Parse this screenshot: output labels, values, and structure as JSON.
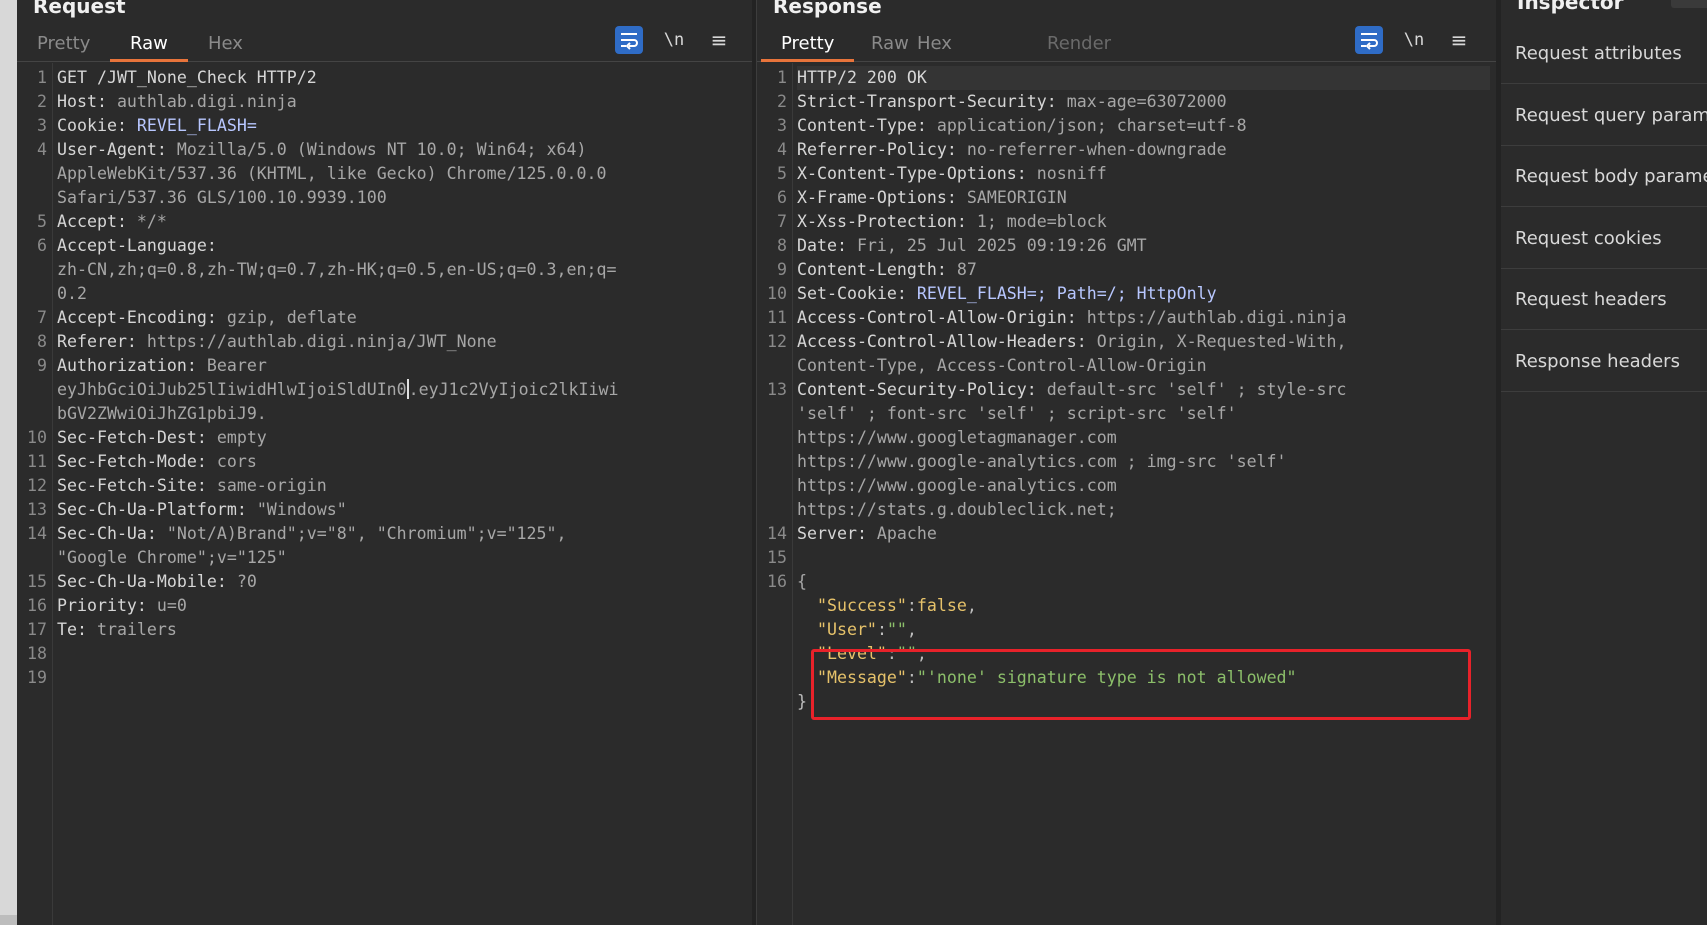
{
  "request": {
    "title": "Request",
    "tabs": [
      "Pretty",
      "Raw",
      "Hex"
    ],
    "active_tab": "Raw",
    "toolbar": {
      "newline_label": "\\n"
    },
    "lines": [
      {
        "n": "1",
        "k": "GET /JWT_None_Check HTTP/2",
        "v": ""
      },
      {
        "n": "2",
        "k": "Host:",
        "v": " authlab.digi.ninja"
      },
      {
        "n": "3",
        "k": "Cookie:",
        "v": " REVEL_FLASH="
      },
      {
        "n": "4",
        "k": "User-Agent:",
        "v": " Mozilla/5.0 (Windows NT 10.0; Win64; x64)"
      },
      {
        "n": "",
        "k": "",
        "v": "AppleWebKit/537.36 (KHTML, like Gecko) Chrome/125.0.0.0"
      },
      {
        "n": "",
        "k": "",
        "v": "Safari/537.36 GLS/100.10.9939.100"
      },
      {
        "n": "5",
        "k": "Accept:",
        "v": " */*"
      },
      {
        "n": "6",
        "k": "Accept-Language:",
        "v": ""
      },
      {
        "n": "",
        "k": "",
        "v": "zh-CN,zh;q=0.8,zh-TW;q=0.7,zh-HK;q=0.5,en-US;q=0.3,en;q="
      },
      {
        "n": "",
        "k": "",
        "v": "0.2"
      },
      {
        "n": "7",
        "k": "Accept-Encoding:",
        "v": " gzip, deflate"
      },
      {
        "n": "8",
        "k": "Referer:",
        "v": " https://authlab.digi.ninja/JWT_None"
      },
      {
        "n": "9",
        "k": "Authorization:",
        "v": " Bearer"
      },
      {
        "n": "",
        "k": "",
        "v": "eyJhbGciOiJub25lIiwidHlwIjoiSldUIn0",
        "after": ".eyJ1c2VyIjoic2lkIiwi"
      },
      {
        "n": "",
        "k": "",
        "v": "bGV2ZWwiOiJhZG1pbiJ9."
      },
      {
        "n": "10",
        "k": "Sec-Fetch-Dest:",
        "v": " empty"
      },
      {
        "n": "11",
        "k": "Sec-Fetch-Mode:",
        "v": " cors"
      },
      {
        "n": "12",
        "k": "Sec-Fetch-Site:",
        "v": " same-origin"
      },
      {
        "n": "13",
        "k": "Sec-Ch-Ua-Platform:",
        "v": " \"Windows\""
      },
      {
        "n": "14",
        "k": "Sec-Ch-Ua:",
        "v": " \"Not/A)Brand\";v=\"8\", \"Chromium\";v=\"125\","
      },
      {
        "n": "",
        "k": "",
        "v": "\"Google Chrome\";v=\"125\""
      },
      {
        "n": "15",
        "k": "Sec-Ch-Ua-Mobile:",
        "v": " ?0"
      },
      {
        "n": "16",
        "k": "Priority:",
        "v": " u=0"
      },
      {
        "n": "17",
        "k": "Te:",
        "v": " trailers"
      },
      {
        "n": "18",
        "k": "",
        "v": ""
      },
      {
        "n": "19",
        "k": "",
        "v": ""
      }
    ]
  },
  "response": {
    "title": "Response",
    "tabs": [
      "Pretty",
      "Raw",
      "Hex",
      "Render"
    ],
    "active_tab": "Pretty",
    "toolbar": {
      "newline_label": "\\n"
    },
    "lines": [
      {
        "n": "1",
        "k": "HTTP/2 200 OK",
        "v": ""
      },
      {
        "n": "2",
        "k": "Strict-Transport-Security:",
        "v": " max-age=63072000"
      },
      {
        "n": "3",
        "k": "Content-Type:",
        "v": " application/json; charset=utf-8"
      },
      {
        "n": "4",
        "k": "Referrer-Policy:",
        "v": " no-referrer-when-downgrade"
      },
      {
        "n": "5",
        "k": "X-Content-Type-Options:",
        "v": " nosniff"
      },
      {
        "n": "6",
        "k": "X-Frame-Options:",
        "v": " SAMEORIGIN"
      },
      {
        "n": "7",
        "k": "X-Xss-Protection:",
        "v": " 1; mode=block"
      },
      {
        "n": "8",
        "k": "Date:",
        "v": " Fri, 25 Jul 2025 09:19:26 GMT"
      },
      {
        "n": "9",
        "k": "Content-Length:",
        "v": " 87"
      },
      {
        "n": "10",
        "k": "Set-Cookie:",
        "v": " REVEL_FLASH=; Path=/; HttpOnly"
      },
      {
        "n": "11",
        "k": "Access-Control-Allow-Origin:",
        "v": " https://authlab.digi.ninja"
      },
      {
        "n": "12",
        "k": "Access-Control-Allow-Headers:",
        "v": " Origin, X-Requested-With,"
      },
      {
        "n": "",
        "k": "",
        "v": "Content-Type, Access-Control-Allow-Origin"
      },
      {
        "n": "13",
        "k": "Content-Security-Policy:",
        "v": " default-src 'self' ; style-src"
      },
      {
        "n": "",
        "k": "",
        "v": "'self' ; font-src 'self' ; script-src 'self'"
      },
      {
        "n": "",
        "k": "",
        "v": "https://www.googletagmanager.com"
      },
      {
        "n": "",
        "k": "",
        "v": "https://www.google-analytics.com ; img-src 'self'"
      },
      {
        "n": "",
        "k": "",
        "v": "https://www.google-analytics.com"
      },
      {
        "n": "",
        "k": "",
        "v": "https://stats.g.doubleclick.net;"
      },
      {
        "n": "14",
        "k": "Server:",
        "v": " Apache"
      },
      {
        "n": "15",
        "k": "",
        "v": ""
      },
      {
        "n": "16",
        "k": "",
        "v": "{"
      }
    ],
    "json_body": [
      {
        "key": "\"Success\"",
        "val": "false",
        "type": "bool",
        "tail": ","
      },
      {
        "key": "\"User\"",
        "val": "\"\"",
        "type": "str",
        "tail": ","
      },
      {
        "key": "\"Level\"",
        "val": "\"\"",
        "type": "str",
        "tail": ","
      },
      {
        "key": "\"Message\"",
        "val": "\"'none' signature type is not allowed\"",
        "type": "str",
        "tail": ""
      }
    ],
    "json_close": "}"
  },
  "inspector": {
    "title": "Inspector",
    "items": [
      "Request attributes",
      "Request query parameters",
      "Request body parameters",
      "Request cookies",
      "Request headers",
      "Response headers"
    ]
  },
  "colors": {
    "accent_tab": "#e8743b",
    "callout": "#e8222a",
    "wrap_button": "#2f6cc6"
  },
  "icons": {
    "wrap": "wrap-lines-icon",
    "menu": "hamburger-menu-icon"
  }
}
